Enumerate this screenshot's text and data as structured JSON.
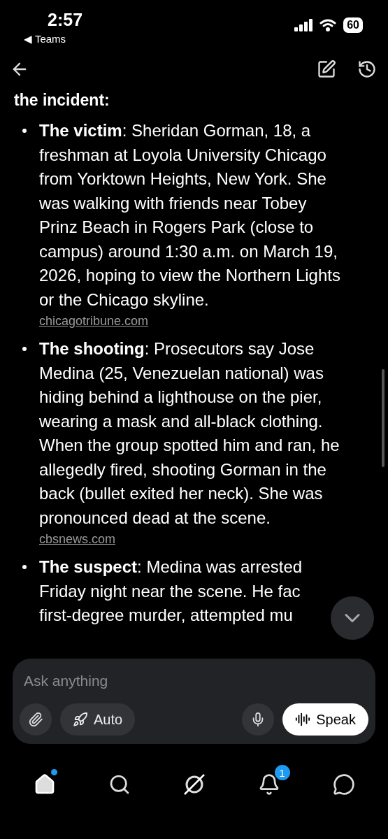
{
  "status_bar": {
    "time": "2:57",
    "back_app": "◀ Teams",
    "battery": "60"
  },
  "content": {
    "heading": "the incident:",
    "items": [
      {
        "kind": "paragraph",
        "text": "**The victim**: Sheridan Gorman, 18, a freshman at Loyola University Chicago from Yorktown Heights, New York. She was walking with friends near Tobey Prinz Beach in Rogers Park (close to campus) around 1:30 a.m. on March 19, 2026, hoping to view the Northern Lights or the Chicago skyline.",
        "source": "chicagotribune.com"
      },
      {
        "kind": "paragraph",
        "text": "**The shooting**: Prosecutors say Jose Medina (25, Venezuelan national) was hiding behind a lighthouse on the pier, wearing a mask and all-black clothing. When the group spotted him and ran, he allegedly fired, shooting Gorman in the back (bullet exited her neck). She was pronounced dead at the scene.",
        "source": "cbsnews.com"
      },
      {
        "kind": "lines",
        "lines": [
          "**The suspect**: Medina was arrested",
          "Friday night near the scene. He fac",
          "first-degree murder, attempted mu"
        ]
      }
    ]
  },
  "composer": {
    "placeholder": "Ask anything",
    "mode": "Auto",
    "speak": "Speak"
  },
  "nav": [
    {
      "kind": "home",
      "selected": true,
      "dot": true
    },
    {
      "kind": "search",
      "selected": false
    },
    {
      "kind": "grok",
      "selected": false
    },
    {
      "kind": "bell",
      "selected": false,
      "badge": "1"
    },
    {
      "kind": "chat",
      "selected": false
    }
  ]
}
